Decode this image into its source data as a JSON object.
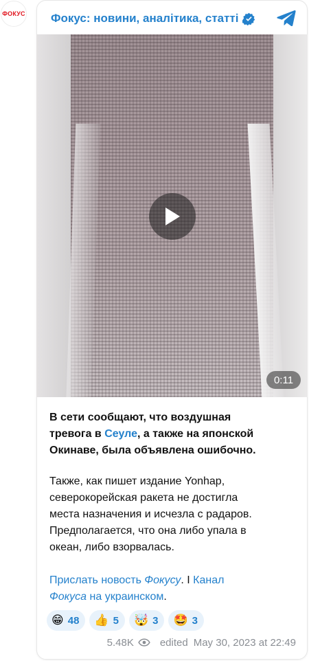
{
  "channel": {
    "avatar_text": "ФОКУС",
    "title": "Фокус: новини, аналітика, статті",
    "verified_icon": "verified-badge-icon",
    "telegram_icon": "telegram-logo-icon",
    "brand_color": "#2481cc",
    "avatar_color": "#e0141e"
  },
  "video": {
    "duration": "0:11",
    "play_icon": "play-icon"
  },
  "message": {
    "para1_a": "В сети сообщают, что воздушная",
    "para1_b": "тревога в ",
    "para1_link": "Сеуле",
    "para1_c": ", а также на японской",
    "para1_d": "Окинаве, была объявлена ошибочно.",
    "para2_l1": "Также, как пишет издание Yonhap,",
    "para2_l2": "северокорейская ракета не достигла",
    "para2_l3": "места назначения и исчезла с радаров.",
    "para2_l4": "Предполагается, что она либо упала в",
    "para2_l5": "океан, либо взорвалась.",
    "links": {
      "send_news_a": "Прислать новость ",
      "send_news_italic": "Фокусу",
      "separator": ". I ",
      "channel_a": "Канал",
      "channel_italic": "Фокуса",
      "channel_b": " на украинском",
      "end": "."
    }
  },
  "reactions": [
    {
      "icon": "grinning-face-icon",
      "emoji": "😁",
      "count": "48"
    },
    {
      "icon": "thumbs-up-icon",
      "emoji": "👍",
      "count": "5"
    },
    {
      "icon": "exploding-head-icon",
      "emoji": "🤯",
      "count": "3"
    },
    {
      "icon": "star-struck-icon",
      "emoji": "🤩",
      "count": "3"
    }
  ],
  "meta": {
    "views": "5.48K",
    "views_icon": "eye-icon",
    "edited": "edited",
    "timestamp": "May 30, 2023 at 22:49"
  }
}
